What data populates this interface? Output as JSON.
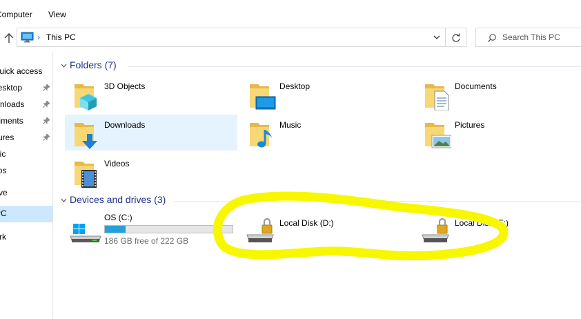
{
  "menu": {
    "computer": "Computer",
    "view": "View"
  },
  "address": {
    "crumb": "This PC",
    "separator": "›"
  },
  "search": {
    "placeholder": "Search This PC"
  },
  "nav": {
    "items": [
      {
        "label": "Quick access",
        "pinned": false
      },
      {
        "label": "Desktop",
        "pinned": true
      },
      {
        "label": "Downloads",
        "pinned": true
      },
      {
        "label": "Documents",
        "pinned": true
      },
      {
        "label": "Pictures",
        "pinned": true
      },
      {
        "label": "Music",
        "pinned": false
      },
      {
        "label": "Videos",
        "pinned": false
      },
      {
        "label": "OneDrive",
        "pinned": false
      },
      {
        "label": "This PC",
        "pinned": false,
        "selected": true
      },
      {
        "label": "Network",
        "pinned": false
      }
    ]
  },
  "folders": {
    "title": "Folders (7)",
    "items": [
      {
        "label": "3D Objects",
        "icon": "3d-objects-folder-icon"
      },
      {
        "label": "Desktop",
        "icon": "desktop-folder-icon"
      },
      {
        "label": "Documents",
        "icon": "documents-folder-icon"
      },
      {
        "label": "Downloads",
        "icon": "downloads-folder-icon",
        "selected": true
      },
      {
        "label": "Music",
        "icon": "music-folder-icon"
      },
      {
        "label": "Pictures",
        "icon": "pictures-folder-icon"
      },
      {
        "label": "Videos",
        "icon": "videos-folder-icon"
      }
    ]
  },
  "drives": {
    "title": "Devices and drives (3)",
    "items": [
      {
        "label": "OS (C:)",
        "free_text": "186 GB free of 222 GB",
        "used_fraction": 0.162,
        "icon": "windows-drive-icon"
      },
      {
        "label": "Local Disk (D:)",
        "icon": "locked-drive-icon"
      },
      {
        "label": "Local Disk (E:)",
        "icon": "locked-drive-icon"
      }
    ]
  },
  "colors": {
    "section_title": "#1e3287",
    "selection": "#cce8ff",
    "hover": "#e5f3ff",
    "drive_fill": "#26a0da",
    "highlight": "#f7f700"
  }
}
